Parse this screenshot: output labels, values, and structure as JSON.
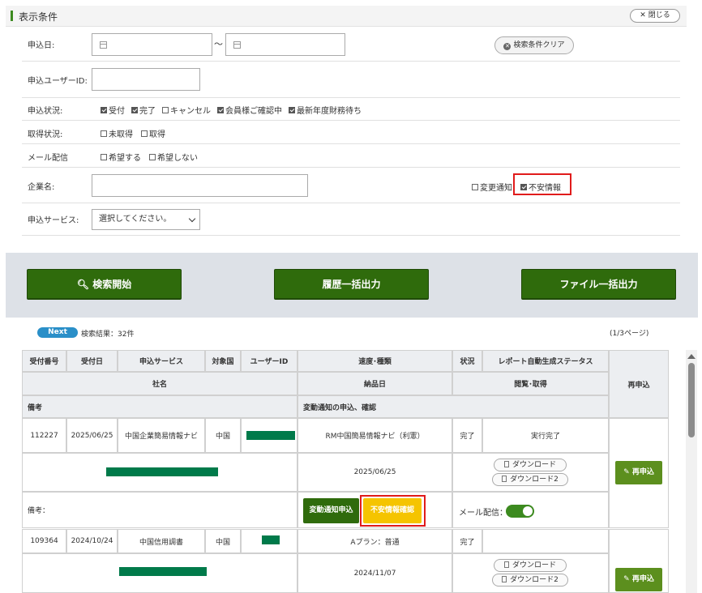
{
  "header": {
    "title": "表示条件",
    "close_label": "閉じる"
  },
  "filters": {
    "apply_date": {
      "label": "申込日:",
      "from": "",
      "to": "",
      "separator": "～"
    },
    "clear_label": "検索条件クリア",
    "user_id": {
      "label": "申込ユーザーID:",
      "value": ""
    },
    "apply_status": {
      "label": "申込状況:",
      "options": [
        {
          "label": "受付",
          "checked": true
        },
        {
          "label": "完了",
          "checked": true
        },
        {
          "label": "キャンセル",
          "checked": false
        },
        {
          "label": "会員様ご確認中",
          "checked": true
        },
        {
          "label": "最新年度財務待ち",
          "checked": true
        }
      ]
    },
    "acquire_status": {
      "label": "取得状況:",
      "options": [
        {
          "label": "未取得",
          "checked": false
        },
        {
          "label": "取得",
          "checked": false
        }
      ]
    },
    "mail": {
      "label": "メール配信",
      "options": [
        {
          "label": "希望する",
          "checked": false
        },
        {
          "label": "希望しない",
          "checked": false
        }
      ]
    },
    "company": {
      "label": "企業名:",
      "value": "",
      "options": [
        {
          "label": "変更通知",
          "checked": false
        },
        {
          "label": "不安情報",
          "checked": true
        }
      ]
    },
    "service": {
      "label": "申込サービス:",
      "selected": "選択してください。"
    }
  },
  "actions": {
    "search": "検索開始",
    "history_export": "履歴一括出力",
    "file_export": "ファイル一括出力"
  },
  "results": {
    "next_label": "Next",
    "count_text": "検索結果：32件",
    "page_text": "(1/3ページ)"
  },
  "table": {
    "headers": {
      "receipt_no": "受付番号",
      "receipt_date": "受付日",
      "service": "申込サービス",
      "country": "対象国",
      "user_id": "ユーザーID",
      "speed_type": "速度･種類",
      "status": "状況",
      "report_status": "レポート自動生成ステータス",
      "reapply": "再申込",
      "company": "社名",
      "delivery_date": "納品日",
      "view_get": "閲覧･取得",
      "remarks": "備考",
      "change_notice": "変動通知の申込、確認"
    },
    "rows": [
      {
        "receipt_no": "112227",
        "receipt_date": "2025/06/25",
        "service": "中国企業簡易情報ナビ",
        "country": "中国",
        "speed_type": "RM中国簡易情報ナビ（利憲）",
        "status": "完了",
        "report_status": "実行完了",
        "delivery_date": "2025/06/25",
        "download_1": "ダウンロード",
        "download_2": "ダウンロード2",
        "reapply": "再申込",
        "remarks_label": "備考：",
        "change_notice_btn": "変動通知申込",
        "anxiety_btn": "不安情報確認",
        "mail_label": "メール配信：",
        "mail_on": true
      },
      {
        "receipt_no": "109364",
        "receipt_date": "2024/10/24",
        "service": "中国信用調書",
        "country": "中国",
        "speed_type": "Aプラン：普通",
        "status": "完了",
        "report_status": "",
        "delivery_date": "2024/11/07",
        "download_1": "ダウンロード",
        "download_2": "ダウンロード2",
        "reapply": "再申込"
      }
    ]
  },
  "colors": {
    "primary_green": "#2f6b0c",
    "highlight_red": "#e01b1b",
    "warning_yellow": "#f5c400",
    "redaction_green": "#007a4a"
  }
}
